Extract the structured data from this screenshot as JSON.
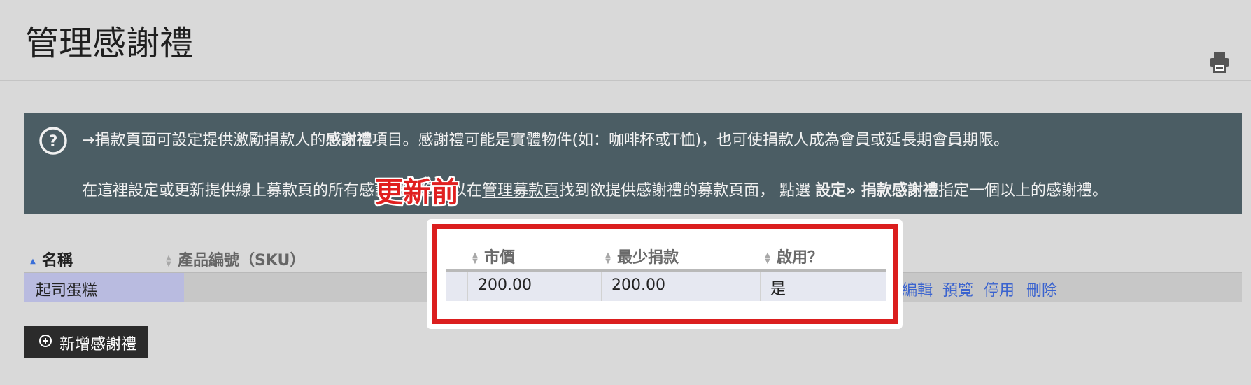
{
  "header": {
    "title": "管理感謝禮",
    "print_icon": "printer-icon"
  },
  "info": {
    "icon": "help-circle-icon",
    "line1": {
      "before": "→捐款頁面可設定提供激勵捐款人的",
      "bold": "感謝禮",
      "after": "項目。感謝禮可能是實體物件(如：咖啡杯或T恤)，也可使捐款人成為會員或延長期會員期限。"
    },
    "line2": {
      "before": "在這裡設定或更新提供線上募款頁的所有",
      "hidden": "感謝禮，您",
      "middle": "可以在",
      "link": "管理募款頁",
      "after": "找到欲提供感謝禮的募款頁面， 點選 ",
      "bold": "設定» 捐款感謝禮",
      "end": "指定一個以上的感謝禮。"
    }
  },
  "table": {
    "headers": {
      "name": "名稱",
      "sku": "產品編號（SKU）"
    },
    "rows": [
      {
        "name": "起司蛋糕"
      }
    ],
    "actions": [
      "編輯",
      "預覽",
      "停用",
      "刪除"
    ]
  },
  "callout": {
    "banner": "更新前",
    "headers": [
      "市價",
      "最少捐款",
      "啟用？"
    ],
    "row": [
      "200.00",
      "200.00",
      "是"
    ]
  },
  "add_button": {
    "label": "新增感謝禮",
    "icon": "plus-circle-icon"
  },
  "colors": {
    "info_bg": "#4b5d64",
    "highlight_red": "#db1e1e",
    "link_blue": "#3a63cf",
    "selected_cell": "#b9bbe0"
  }
}
